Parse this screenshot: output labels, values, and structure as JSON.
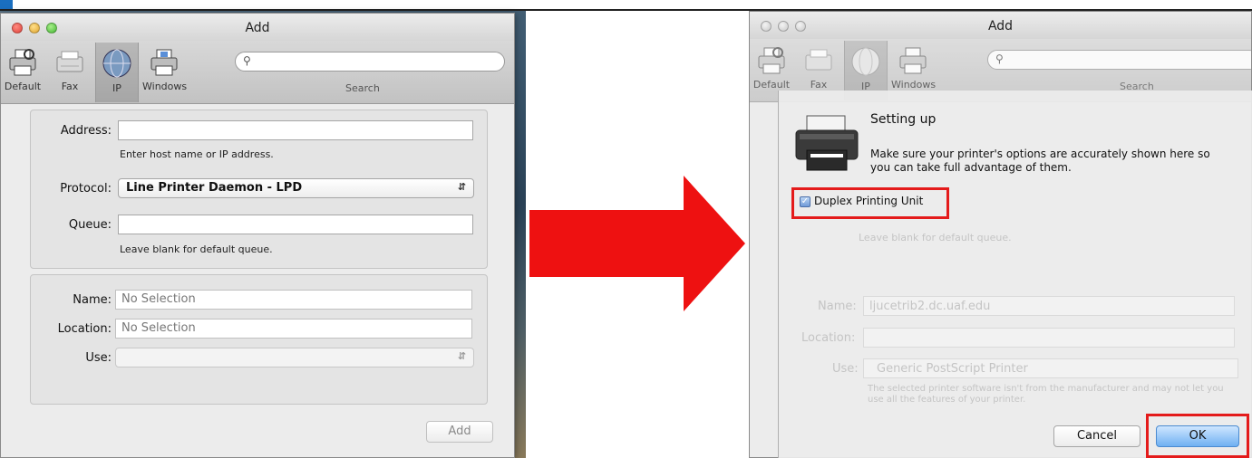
{
  "left_window": {
    "title": "Add",
    "toolbar": {
      "items": [
        {
          "label": "Default",
          "icon": "printer-icon"
        },
        {
          "label": "Fax",
          "icon": "fax-icon"
        },
        {
          "label": "IP",
          "icon": "globe-icon"
        },
        {
          "label": "Windows",
          "icon": "windows-printer-icon"
        }
      ],
      "search_label": "Search"
    },
    "form": {
      "address_label": "Address:",
      "address_value": "",
      "address_hint": "Enter host name or IP address.",
      "protocol_label": "Protocol:",
      "protocol_value": "Line Printer Daemon - LPD",
      "queue_label": "Queue:",
      "queue_value": "",
      "queue_hint": "Leave blank for default queue.",
      "name_label": "Name:",
      "name_value": "No Selection",
      "location_label": "Location:",
      "location_value": "No Selection",
      "use_label": "Use:",
      "use_value": ""
    },
    "add_button": "Add"
  },
  "right_window": {
    "title": "Add",
    "toolbar": {
      "items": [
        {
          "label": "Default",
          "icon": "printer-icon"
        },
        {
          "label": "Fax",
          "icon": "fax-icon"
        },
        {
          "label": "IP",
          "icon": "globe-icon"
        },
        {
          "label": "Windows",
          "icon": "windows-printer-icon"
        }
      ],
      "search_label": "Search"
    },
    "sheet": {
      "title": "Setting up",
      "message": "Make sure your printer's options are accurately shown here so you can take full advantage of them.",
      "option_label": "Duplex Printing Unit",
      "option_checked": true,
      "cancel_button": "Cancel",
      "ok_button": "OK"
    },
    "background_form": {
      "name_label": "Name:",
      "name_value": "ljucetrib2.dc.uaf.edu",
      "location_label": "Location:",
      "use_label": "Use:",
      "use_value": "Generic PostScript Printer",
      "queue_hint": "Leave blank for default queue.",
      "driver_note": "The selected printer software isn't from the manufacturer and may not let you use all the features of your printer."
    }
  },
  "colors": {
    "highlight": "#e41b1b",
    "arrow": "#ee1111",
    "ok_button": "#6fb0f2"
  }
}
